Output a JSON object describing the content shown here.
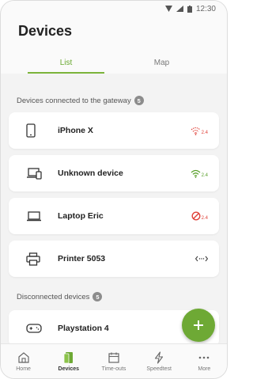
{
  "status_bar": {
    "time": "12:30"
  },
  "header": {
    "title": "Devices"
  },
  "tabs": [
    {
      "label": "List",
      "active": true
    },
    {
      "label": "Map",
      "active": false
    }
  ],
  "sections": {
    "connected": {
      "label": "Devices connected to the gateway",
      "count": "5"
    },
    "disconnected": {
      "label": "Disconnected devices",
      "count": "5"
    }
  },
  "connected_devices": [
    {
      "name": "iPhone X",
      "icon": "phone-icon",
      "connection": "wifi-weak-icon",
      "band": "2.4"
    },
    {
      "name": "Unknown device",
      "icon": "devices-icon",
      "connection": "wifi-strong-icon",
      "band": "2.4"
    },
    {
      "name": "Laptop Eric",
      "icon": "laptop-icon",
      "connection": "blocked-icon",
      "band": "2.4"
    },
    {
      "name": "Printer 5053",
      "icon": "printer-icon",
      "connection": "ethernet-icon",
      "band": ""
    }
  ],
  "disconnected_devices": [
    {
      "name": "Playstation 4",
      "icon": "gamepad-icon"
    }
  ],
  "bottom_nav": [
    {
      "label": "Home",
      "icon": "home-icon",
      "active": false
    },
    {
      "label": "Devices",
      "icon": "devices-nav-icon",
      "active": true
    },
    {
      "label": "Time-outs",
      "icon": "calendar-icon",
      "active": false
    },
    {
      "label": "Speedtest",
      "icon": "lightning-icon",
      "active": false
    },
    {
      "label": "More",
      "icon": "more-icon",
      "active": false
    }
  ],
  "colors": {
    "accent": "#6ea935",
    "wifi_weak": "#e0423a",
    "wifi_strong": "#5aa02c",
    "blocked": "#e0423a"
  }
}
